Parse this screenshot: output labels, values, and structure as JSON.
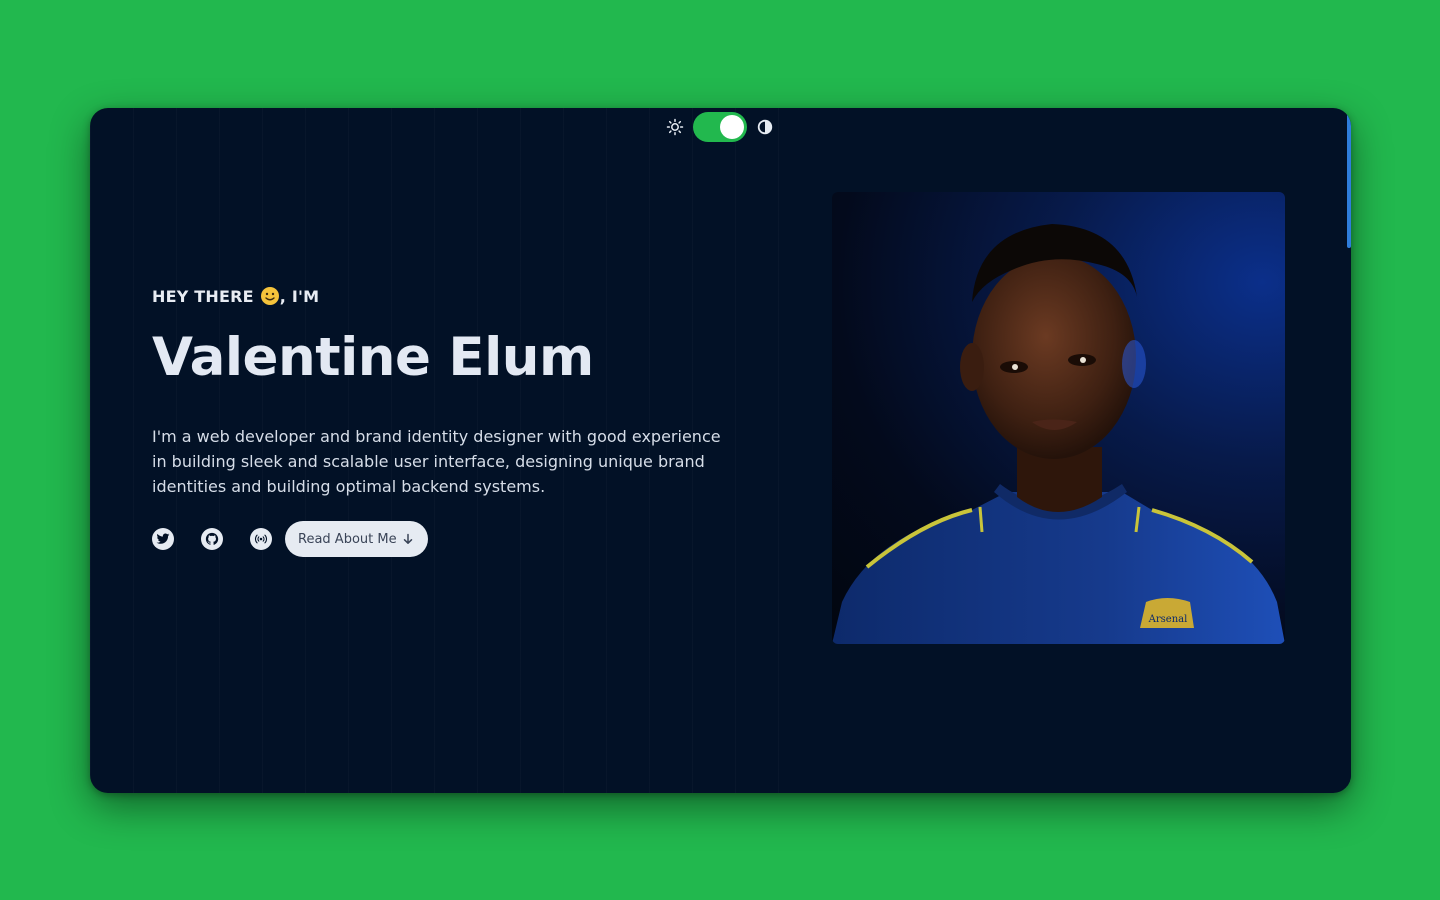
{
  "theme_switch": {
    "light_icon": "sun-icon",
    "dark_icon": "contrast-icon",
    "state": "on",
    "color": "#22b84e"
  },
  "hero": {
    "greeting_before": "HEY THERE",
    "greeting_emoji": "slightly-smiling-face",
    "greeting_after": ", I'M",
    "name": "Valentine Elum",
    "bio": "I'm a web developer and brand identity designer with good experience in building sleek and scalable user interface, designing unique brand identities and building optimal backend systems.",
    "social_links": [
      "twitter-icon",
      "github-icon",
      "podcast-icon"
    ],
    "cta_label": "Read About Me",
    "cta_icon": "arrow-down-icon"
  },
  "photo": {
    "jersey_text": "Arsenal"
  },
  "colors": {
    "background": "#22b84e",
    "window": "#021126",
    "text": "#e3e9f3",
    "button": "#e6ebf2",
    "accent": "#2f7ddb"
  }
}
